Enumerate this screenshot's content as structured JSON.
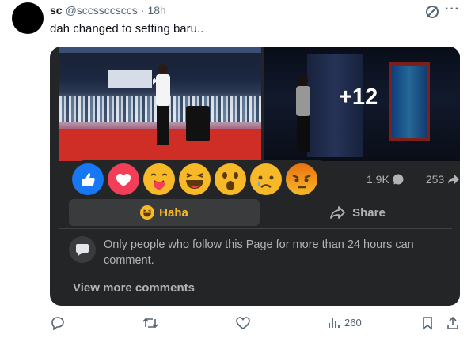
{
  "tweet": {
    "display_name": "sc",
    "handle": "@sccssccsccs",
    "separator": "·",
    "time": "18h",
    "text": "dah changed to setting baru..",
    "icons": [
      "grok-icon",
      "more-icon"
    ],
    "more_label": "···"
  },
  "fb_card": {
    "photo_overlay_count": "+12",
    "reactions": [
      "like",
      "love",
      "care",
      "haha",
      "wow",
      "sad",
      "angry"
    ],
    "comments_count": "1.9K",
    "shares_count": "253",
    "selected_reaction_label": "Haha",
    "share_label": "Share",
    "comment_restriction": "Only people who follow this Page for more than 24 hours can comment.",
    "view_more_label": "View more comments",
    "colors": {
      "card_bg": "#242526",
      "haha": "#f7b928",
      "like": "#1877f2",
      "love": "#f33e58",
      "angry": "#e9710f"
    }
  },
  "footer": {
    "views": "260",
    "icons": [
      "reply-icon",
      "retweet-icon",
      "like-icon",
      "views-icon",
      "bookmark-icon",
      "share-icon"
    ]
  }
}
